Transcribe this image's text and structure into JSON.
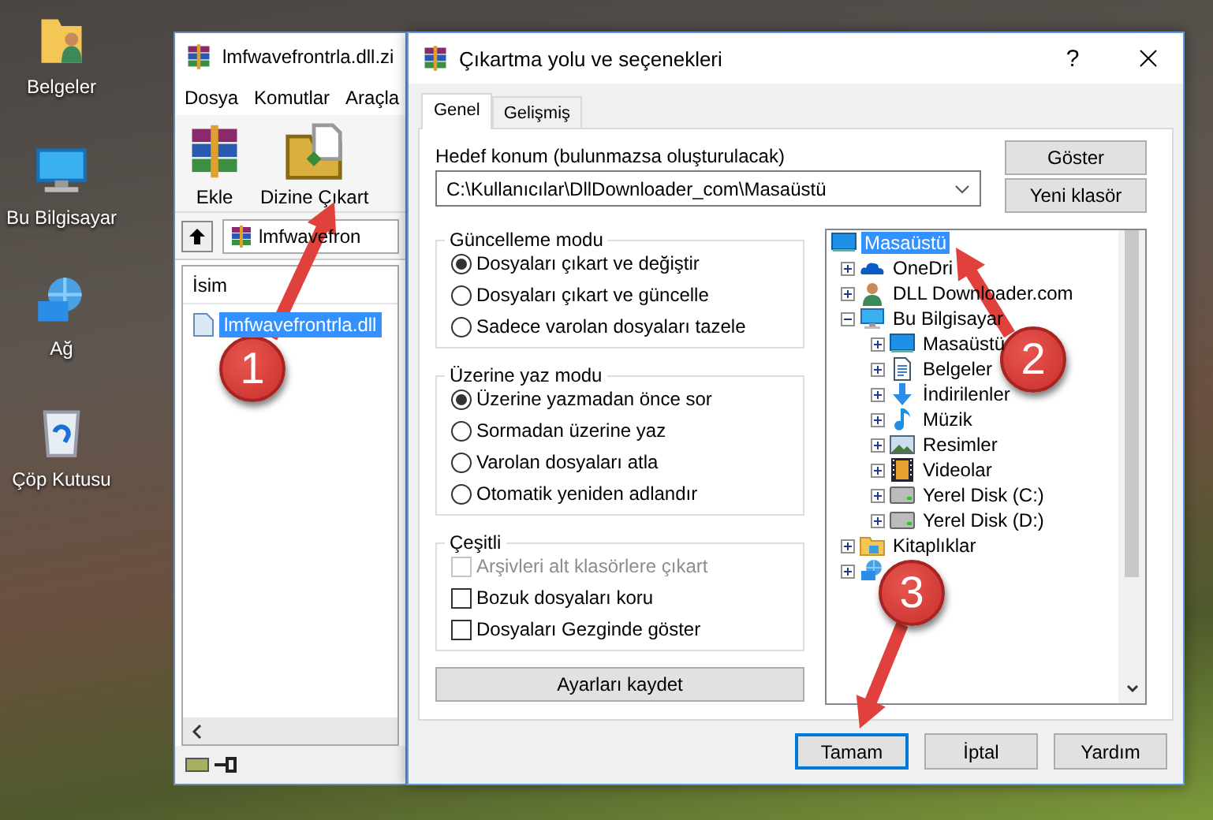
{
  "desktop_icons": [
    {
      "label": "Belgeler",
      "kind": "documents"
    },
    {
      "label": "Bu Bilgisayar",
      "kind": "computer"
    },
    {
      "label": "Ağ",
      "kind": "network"
    },
    {
      "label": "Çöp Kutusu",
      "kind": "recycle"
    }
  ],
  "archiver_window": {
    "title": "lmfwavefrontrla.dll.zi",
    "menu": [
      "Dosya",
      "Komutlar",
      "Araçla"
    ],
    "toolbar": [
      {
        "label": "Ekle",
        "kind": "add"
      },
      {
        "label": "Dizine Çıkart",
        "kind": "extract"
      }
    ],
    "address": "lmfwavefron",
    "columns": [
      "İsim"
    ],
    "files": [
      {
        "name": "lmfwavefrontrla.dll",
        "selected": true
      }
    ]
  },
  "dialog": {
    "title": "Çıkartma yolu ve seçenekleri",
    "help_button": "?",
    "tabs": [
      {
        "label": "Genel",
        "selected": true
      },
      {
        "label": "Gelişmiş",
        "selected": false
      }
    ],
    "destination_label": "Hedef konum (bulunmazsa oluşturulacak)",
    "destination_value": "C:\\Kullanıcılar\\DllDownloader_com\\Masaüstü",
    "side_buttons": [
      "Göster",
      "Yeni klasör"
    ],
    "groups": [
      {
        "title": "Güncelleme modu",
        "options": [
          {
            "kind": "radio",
            "label": "Dosyaları çıkart ve değiştir",
            "selected": true
          },
          {
            "kind": "radio",
            "label": "Dosyaları çıkart ve güncelle",
            "selected": false
          },
          {
            "kind": "radio",
            "label": "Sadece varolan dosyaları tazele",
            "selected": false
          }
        ]
      },
      {
        "title": "Üzerine yaz modu",
        "options": [
          {
            "kind": "radio",
            "label": "Üzerine yazmadan önce sor",
            "selected": true
          },
          {
            "kind": "radio",
            "label": "Sormadan üzerine yaz",
            "selected": false
          },
          {
            "kind": "radio",
            "label": "Varolan dosyaları atla",
            "selected": false
          },
          {
            "kind": "radio",
            "label": "Otomatik yeniden adlandır",
            "selected": false
          }
        ]
      },
      {
        "title": "Çeşitli",
        "options": [
          {
            "kind": "checkbox",
            "label": "Arşivleri alt klasörlere çıkart",
            "checked": false,
            "disabled": true
          },
          {
            "kind": "checkbox",
            "label": "Bozuk dosyaları koru",
            "checked": false,
            "disabled": false
          },
          {
            "kind": "checkbox",
            "label": "Dosyaları Gezginde göster",
            "checked": false,
            "disabled": false
          }
        ]
      }
    ],
    "save_button": "Ayarları kaydet",
    "tree": [
      {
        "label": "Masaüstü",
        "kind": "desktop",
        "selected": true,
        "children": [
          {
            "label": "OneDri",
            "kind": "cloud",
            "selected": false,
            "expanded": false
          },
          {
            "label": "DLL Downloader.com",
            "kind": "user",
            "selected": false,
            "expanded": false
          },
          {
            "label": "Bu Bilgisayar",
            "kind": "computer",
            "selected": false,
            "expanded": true,
            "children": [
              {
                "label": "Masaüstü",
                "kind": "desktop",
                "selected": false,
                "expanded": false
              },
              {
                "label": "Belgeler",
                "kind": "docs",
                "selected": false,
                "expanded": false
              },
              {
                "label": "İndirilenler",
                "kind": "download",
                "selected": false,
                "expanded": false
              },
              {
                "label": "Müzik",
                "kind": "music",
                "selected": false,
                "expanded": false
              },
              {
                "label": "Resimler",
                "kind": "pictures",
                "selected": false,
                "expanded": false
              },
              {
                "label": "Videolar",
                "kind": "videos",
                "selected": false,
                "expanded": false
              },
              {
                "label": "Yerel Disk (C:)",
                "kind": "disk",
                "selected": false,
                "expanded": false
              },
              {
                "label": "Yerel Disk (D:)",
                "kind": "disk",
                "selected": false,
                "expanded": false
              }
            ]
          },
          {
            "label": "Kitaplıklar",
            "kind": "library",
            "selected": false,
            "expanded": false
          },
          {
            "kind": "network",
            "selected": false,
            "expanded": false
          }
        ]
      }
    ],
    "buttons": [
      {
        "label": "Tamam",
        "default": true
      },
      {
        "label": "İptal",
        "default": false
      },
      {
        "label": "Yardım",
        "default": false
      }
    ]
  },
  "annotations": [
    {
      "number": "1"
    },
    {
      "number": "2"
    },
    {
      "number": "3"
    }
  ]
}
